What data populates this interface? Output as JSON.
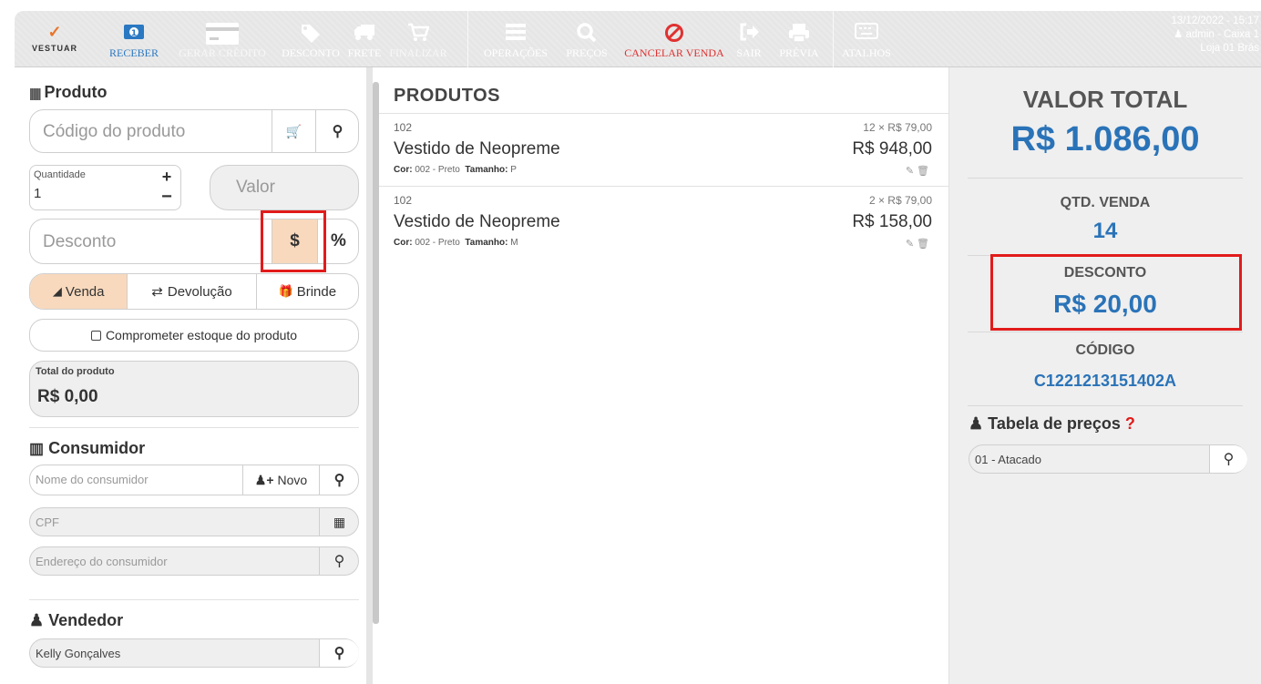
{
  "toolbar": {
    "logo_text": "VESTUAR",
    "buttons": [
      {
        "label": "RECEBER",
        "icon": "money-icon"
      },
      {
        "label": "GERAR CRÉDITO",
        "icon": "credit-card-icon"
      },
      {
        "label": "DESCONTO",
        "icon": "tags-icon"
      },
      {
        "label": "FRETE",
        "icon": "truck-icon"
      },
      {
        "label": "FINALIZAR",
        "icon": "cart-icon"
      },
      {
        "label": "OPERAÇÕES",
        "icon": "menu-icon"
      },
      {
        "label": "PREÇOS",
        "icon": "search-icon"
      },
      {
        "label": "CANCELAR VENDA",
        "icon": "cancel-icon"
      },
      {
        "label": "SAIR",
        "icon": "sign-out-icon"
      },
      {
        "label": "PRÉVIA",
        "icon": "print-icon"
      },
      {
        "label": "ATALHOS",
        "icon": "keyboard-icon"
      }
    ],
    "datetime": "13/12/2022 - 15:17",
    "user": "admin - Caixa 1",
    "store": "Loja 01 Brás"
  },
  "produto": {
    "title": "Produto",
    "codigo_placeholder": "Código do produto",
    "quantidade_label": "Quantidade",
    "quantidade_value": "1",
    "valor_placeholder": "Valor",
    "desconto_placeholder": "Desconto",
    "desconto_currency": "$",
    "desconto_percent": "%",
    "tipo_venda": "Venda",
    "tipo_devolucao": "Devolução",
    "tipo_brinde": "Brinde",
    "comprometer_estoque": "Comprometer estoque do produto",
    "total_label": "Total do produto",
    "total_value": "R$ 0,00"
  },
  "consumidor": {
    "title": "Consumidor",
    "nome_placeholder": "Nome do consumidor",
    "novo_label": "Novo",
    "cpf_placeholder": "CPF",
    "endereco_placeholder": "Endereço do consumidor"
  },
  "vendedor": {
    "title": "Vendedor",
    "value": "Kelly Gonçalves"
  },
  "produtos": {
    "title": "PRODUTOS",
    "items": [
      {
        "code": "102",
        "name": "Vestido de Neopreme",
        "cor_label": "Cor:",
        "cor": "002 - Preto",
        "tamanho_label": "Tamanho:",
        "tamanho": "P",
        "unit": "12 × R$ 79,00",
        "total": "R$ 948,00"
      },
      {
        "code": "102",
        "name": "Vestido de Neopreme",
        "cor_label": "Cor:",
        "cor": "002 - Preto",
        "tamanho_label": "Tamanho:",
        "tamanho": "M",
        "unit": "2 × R$ 79,00",
        "total": "R$ 158,00"
      }
    ]
  },
  "resumo": {
    "valor_total_label": "VALOR TOTAL",
    "valor_total": "R$ 1.086,00",
    "qtd_venda_label": "QTD. VENDA",
    "qtd_venda": "14",
    "desconto_label": "DESCONTO",
    "desconto": "R$ 20,00",
    "codigo_label": "CÓDIGO",
    "codigo": "C1221213151402A",
    "tabela_precos_title": "Tabela de preços",
    "tabela_precos_help": "?",
    "tabela_precos_value": "01 - Atacado"
  },
  "colors": {
    "accent_blue": "#2a73b8",
    "active_orange": "#f8d9bd",
    "highlight_red": "#e21b1b",
    "cancel_red": "#e03131"
  }
}
